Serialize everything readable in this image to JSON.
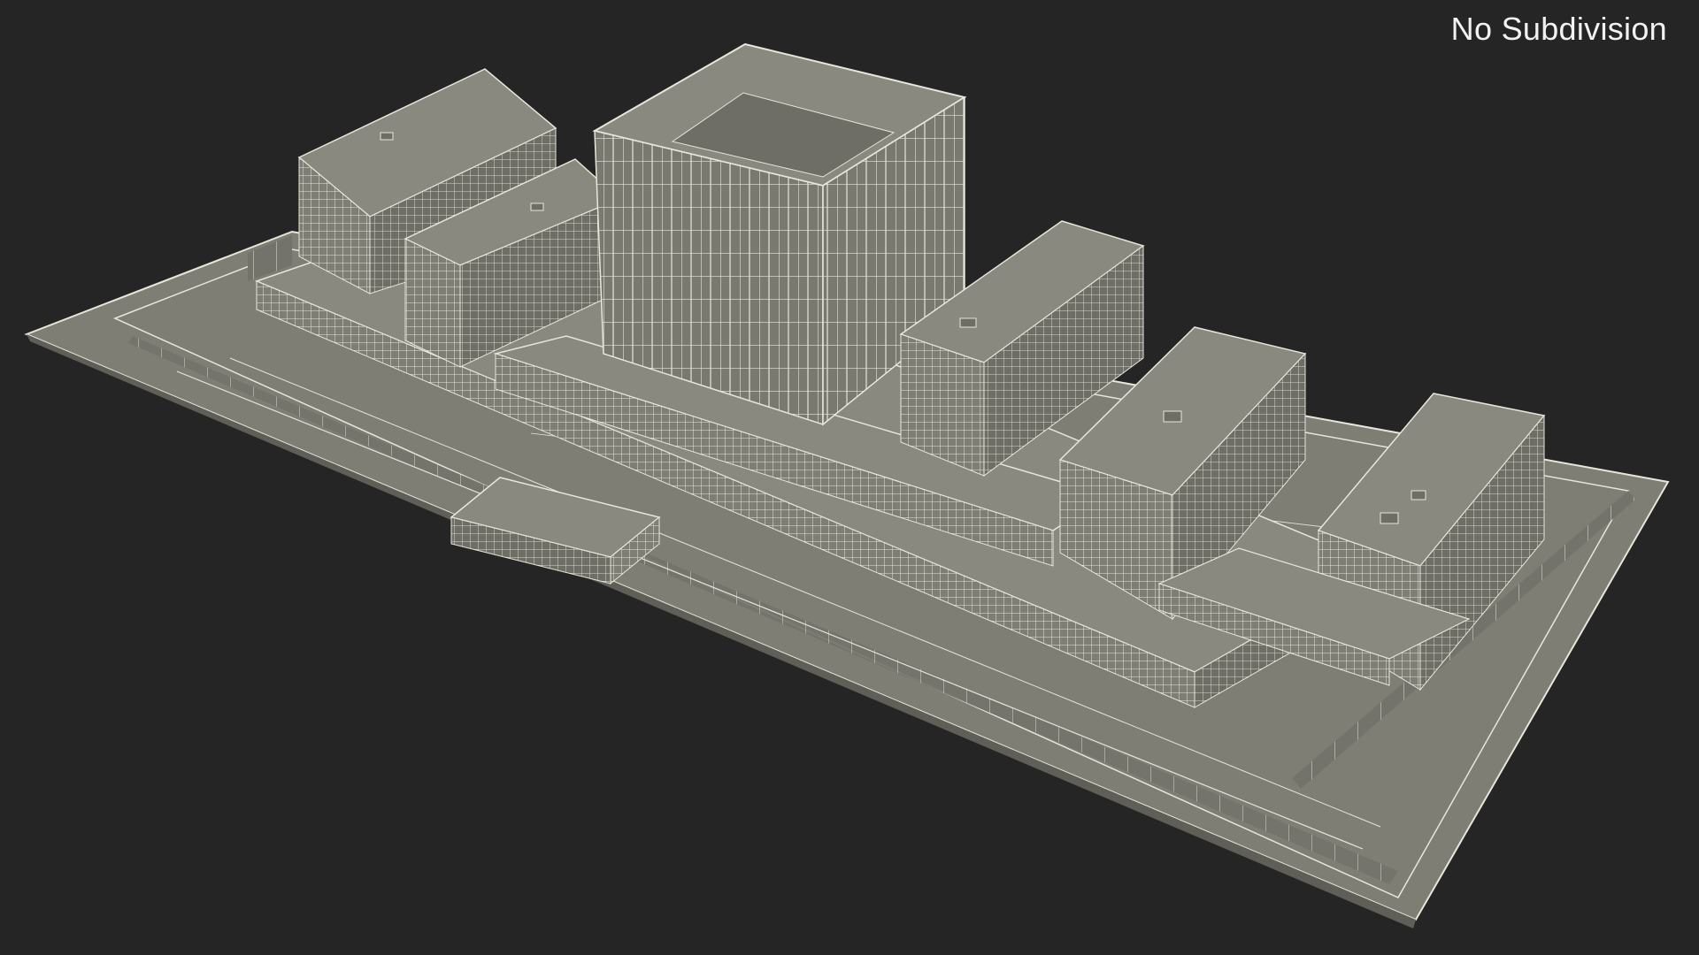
{
  "viewport": {
    "caption": "No Subdivision",
    "background_color": "#252525",
    "model_fill_color": "#7f7e75",
    "wire_color": "#e8e6da",
    "shadow_color": "#5d5c55"
  }
}
